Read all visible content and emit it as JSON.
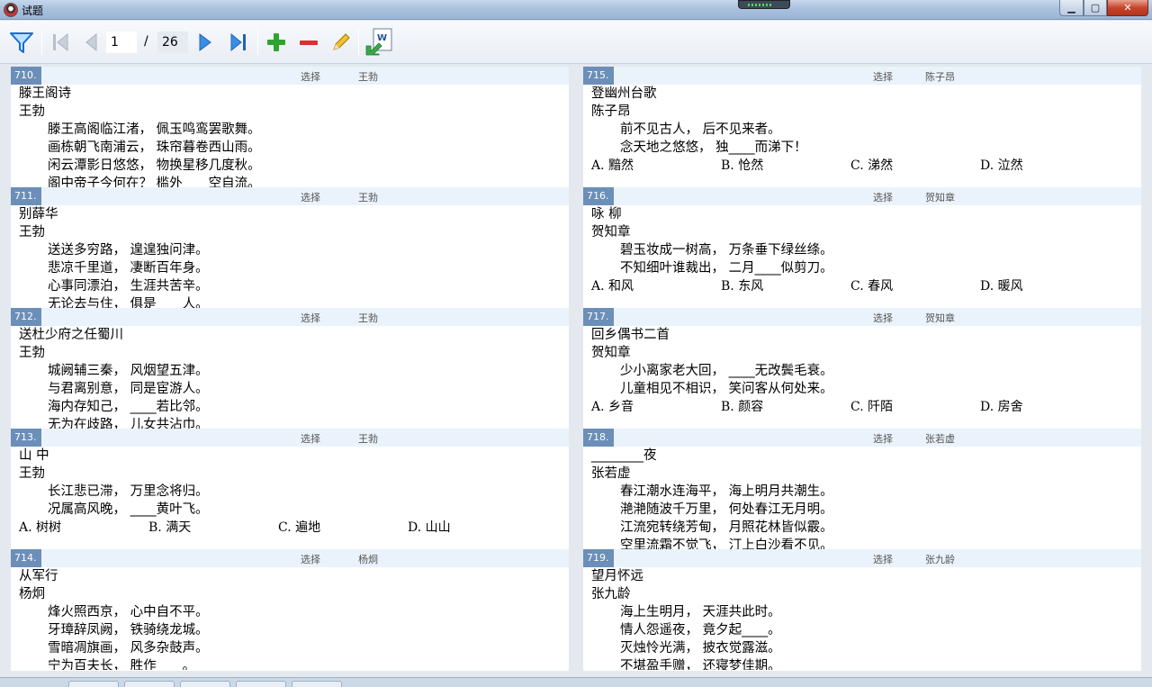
{
  "window": {
    "title": "试题",
    "minimize": "▁",
    "maximize": "▢",
    "close": "✕"
  },
  "toolbar": {
    "filter_icon": "filter-icon",
    "first_icon": "first-page-icon",
    "prev_icon": "prev-page-icon",
    "next_icon": "next-page-icon",
    "last_icon": "last-page-icon",
    "add_icon": "plus-icon",
    "remove_icon": "minus-icon",
    "edit_icon": "pencil-icon",
    "export_icon": "word-export-icon",
    "current_page": "1",
    "page_separator": "/",
    "total_pages": "26"
  },
  "colors": {
    "header_bg": "#eaf3fb",
    "qnum_bg": "#6b8fb8",
    "add_green": "#2fa32f",
    "remove_red": "#d93030",
    "nav_blue": "#2f7fd6"
  },
  "left_column": [
    {
      "num": "710.",
      "type": "选择",
      "author": "王勃",
      "title": "滕王阁诗",
      "poet": "王勃",
      "lines": [
        "滕王高阁临江渚， 佩玉鸣鸾罢歌舞。",
        "画栋朝飞南浦云， 珠帘暮卷西山雨。",
        "闲云潭影日悠悠， 物换星移几度秋。",
        "阁中帝子今何在？ 槛外____空自流。"
      ],
      "options": []
    },
    {
      "num": "711.",
      "type": "选择",
      "author": "王勃",
      "title": "别薛华",
      "poet": "王勃",
      "lines": [
        "送送多穷路， 遑遑独问津。",
        "悲凉千里道， 凄断百年身。",
        "心事同漂泊， 生涯共苦辛。",
        "无论去与住， 俱是____人。"
      ],
      "options": []
    },
    {
      "num": "712.",
      "type": "选择",
      "author": "王勃",
      "title": "送杜少府之任蜀川",
      "poet": "王勃",
      "lines": [
        "城阙辅三秦， 风烟望五津。",
        "与君离别意， 同是宦游人。",
        "海内存知己， ____若比邻。",
        "无为在歧路， 儿女共沾巾。"
      ],
      "options": []
    },
    {
      "num": "713.",
      "type": "选择",
      "author": "王勃",
      "title": "山 中",
      "poet": "王勃",
      "lines": [
        "长江悲已滞， 万里念将归。",
        "况属高风晚， ____黄叶飞。"
      ],
      "options": [
        "A. 树树",
        "B. 满天",
        "C. 遍地",
        "D. 山山"
      ]
    },
    {
      "num": "714.",
      "type": "选择",
      "author": "杨炯",
      "title": "从军行",
      "poet": "杨炯",
      "lines": [
        "烽火照西京， 心中自不平。",
        "牙璋辞凤阙， 铁骑绕龙城。",
        "雪暗凋旗画， 风多杂鼓声。",
        "宁为百夫长， 胜作____。"
      ],
      "options": []
    }
  ],
  "right_column": [
    {
      "num": "715.",
      "type": "选择",
      "author": "陈子昂",
      "title": "登幽州台歌",
      "poet": "陈子昂",
      "lines": [
        "前不见古人， 后不见来者。",
        "念天地之悠悠， 独____而涕下！"
      ],
      "options": [
        "A. 黯然",
        "B. 怆然",
        "C. 涕然",
        "D. 泣然"
      ]
    },
    {
      "num": "716.",
      "type": "选择",
      "author": "贺知章",
      "title": "咏 柳",
      "poet": "贺知章",
      "lines": [
        "碧玉妆成一树高， 万条垂下绿丝绦。",
        "不知细叶谁裁出， 二月____似剪刀。"
      ],
      "options": [
        "A. 和风",
        "B. 东风",
        "C. 春风",
        "D. 暖风"
      ]
    },
    {
      "num": "717.",
      "type": "选择",
      "author": "贺知章",
      "title": "回乡偶书二首",
      "poet": "贺知章",
      "lines": [
        "少小离家老大回， ____无改鬓毛衰。",
        "儿童相见不相识， 笑问客从何处来。"
      ],
      "options": [
        "A. 乡音",
        "B. 颜容",
        "C. 阡陌",
        "D. 房舍"
      ]
    },
    {
      "num": "718.",
      "type": "选择",
      "author": "张若虚",
      "title": "________夜",
      "poet": "张若虚",
      "lines": [
        "春江潮水连海平， 海上明月共潮生。",
        "滟滟随波千万里， 何处春江无月明。",
        "江流宛转绕芳甸， 月照花林皆似霰。",
        "空里流霜不觉飞， 汀上白沙看不见。"
      ],
      "options": []
    },
    {
      "num": "719.",
      "type": "选择",
      "author": "张九龄",
      "title": "望月怀远",
      "poet": "张九龄",
      "lines": [
        "海上生明月， 天涯共此时。",
        "情人怨遥夜， 竟夕起____。",
        "灭烛怜光满， 披衣觉露滋。",
        "不堪盈手赠， 还寝梦佳期。"
      ],
      "options": []
    }
  ]
}
